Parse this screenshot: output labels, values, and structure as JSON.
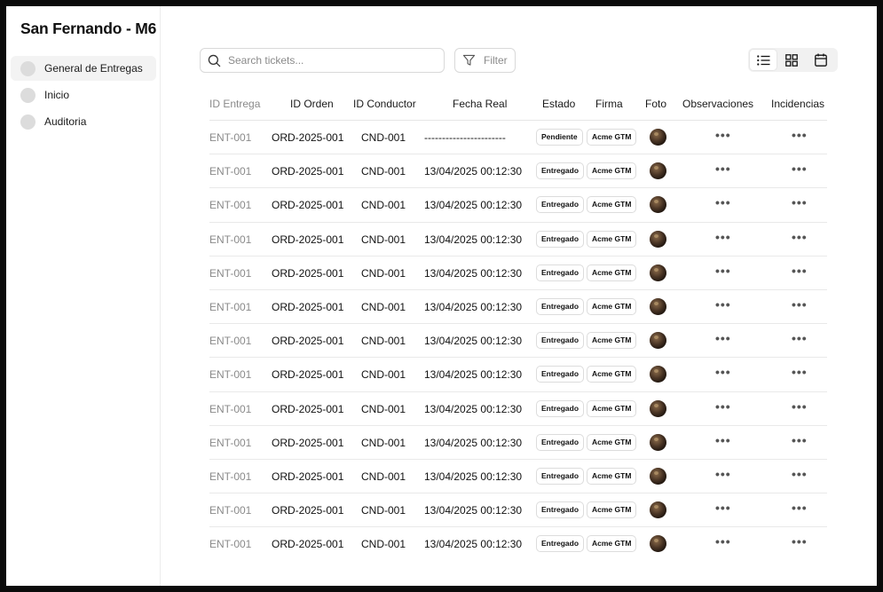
{
  "sidebar": {
    "title": "San Fernando - M6",
    "items": [
      {
        "label": "General de Entregas"
      },
      {
        "label": "Inicio"
      },
      {
        "label": "Auditoria"
      }
    ]
  },
  "toolbar": {
    "search_placeholder": "Search tickets...",
    "filter_label": "Filter",
    "search_icon": "search-icon",
    "filter_icon": "funnel-icon",
    "views": [
      "list-view-icon",
      "grid-view-icon",
      "calendar-icon"
    ],
    "active_view": "list"
  },
  "table": {
    "columns": [
      "ID Entrega",
      "ID Orden",
      "ID Conductor",
      "Fecha Real",
      "Estado",
      "Firma",
      "Foto",
      "Observaciones",
      "Incidencias"
    ],
    "rows": [
      {
        "id": "ENT-001",
        "orden": "ORD-2025-001",
        "conductor": "CND-001",
        "fecha": "-----------------------",
        "estado": "Pendiente",
        "firma": "Acme GTM",
        "obs": "•••",
        "inc": "•••"
      },
      {
        "id": "ENT-001",
        "orden": "ORD-2025-001",
        "conductor": "CND-001",
        "fecha": "13/04/2025 00:12:30",
        "estado": "Entregado",
        "firma": "Acme GTM",
        "obs": "•••",
        "inc": "•••"
      },
      {
        "id": "ENT-001",
        "orden": "ORD-2025-001",
        "conductor": "CND-001",
        "fecha": "13/04/2025 00:12:30",
        "estado": "Entregado",
        "firma": "Acme GTM",
        "obs": "•••",
        "inc": "•••"
      },
      {
        "id": "ENT-001",
        "orden": "ORD-2025-001",
        "conductor": "CND-001",
        "fecha": "13/04/2025 00:12:30",
        "estado": "Entregado",
        "firma": "Acme GTM",
        "obs": "•••",
        "inc": "•••"
      },
      {
        "id": "ENT-001",
        "orden": "ORD-2025-001",
        "conductor": "CND-001",
        "fecha": "13/04/2025 00:12:30",
        "estado": "Entregado",
        "firma": "Acme GTM",
        "obs": "•••",
        "inc": "•••"
      },
      {
        "id": "ENT-001",
        "orden": "ORD-2025-001",
        "conductor": "CND-001",
        "fecha": "13/04/2025 00:12:30",
        "estado": "Entregado",
        "firma": "Acme GTM",
        "obs": "•••",
        "inc": "•••"
      },
      {
        "id": "ENT-001",
        "orden": "ORD-2025-001",
        "conductor": "CND-001",
        "fecha": "13/04/2025 00:12:30",
        "estado": "Entregado",
        "firma": "Acme GTM",
        "obs": "•••",
        "inc": "•••"
      },
      {
        "id": "ENT-001",
        "orden": "ORD-2025-001",
        "conductor": "CND-001",
        "fecha": "13/04/2025 00:12:30",
        "estado": "Entregado",
        "firma": "Acme GTM",
        "obs": "•••",
        "inc": "•••"
      },
      {
        "id": "ENT-001",
        "orden": "ORD-2025-001",
        "conductor": "CND-001",
        "fecha": "13/04/2025 00:12:30",
        "estado": "Entregado",
        "firma": "Acme GTM",
        "obs": "•••",
        "inc": "•••"
      },
      {
        "id": "ENT-001",
        "orden": "ORD-2025-001",
        "conductor": "CND-001",
        "fecha": "13/04/2025 00:12:30",
        "estado": "Entregado",
        "firma": "Acme GTM",
        "obs": "•••",
        "inc": "•••"
      },
      {
        "id": "ENT-001",
        "orden": "ORD-2025-001",
        "conductor": "CND-001",
        "fecha": "13/04/2025 00:12:30",
        "estado": "Entregado",
        "firma": "Acme GTM",
        "obs": "•••",
        "inc": "•••"
      },
      {
        "id": "ENT-001",
        "orden": "ORD-2025-001",
        "conductor": "CND-001",
        "fecha": "13/04/2025 00:12:30",
        "estado": "Entregado",
        "firma": "Acme GTM",
        "obs": "•••",
        "inc": "•••"
      },
      {
        "id": "ENT-001",
        "orden": "ORD-2025-001",
        "conductor": "CND-001",
        "fecha": "13/04/2025 00:12:30",
        "estado": "Entregado",
        "firma": "Acme GTM",
        "obs": "•••",
        "inc": "•••"
      }
    ]
  },
  "colors": {
    "frame": "#0b0b0b",
    "background": "#ffffff",
    "muted_text": "#8a8a8a",
    "border": "#d9d9d9"
  }
}
